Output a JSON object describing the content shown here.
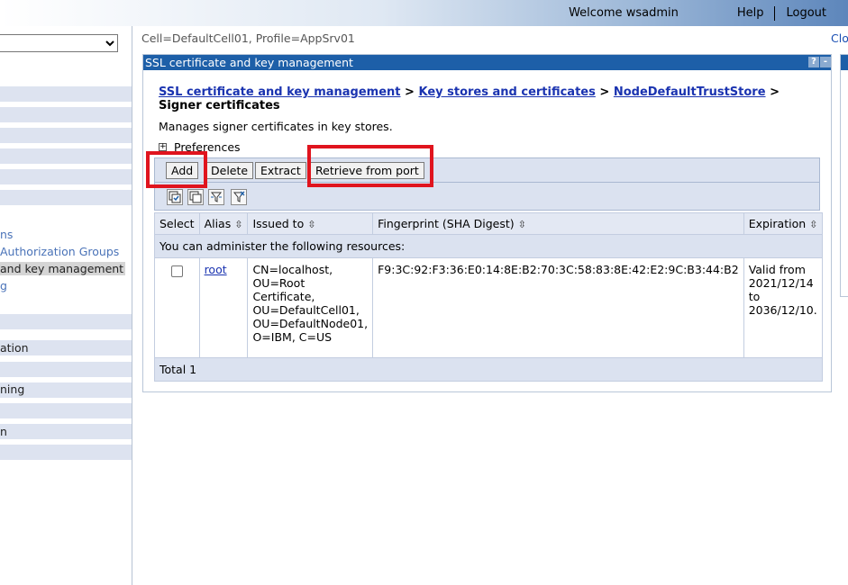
{
  "banner": {
    "welcome": "Welcome wsadmin",
    "help": "Help",
    "logout": "Logout"
  },
  "nav": {
    "select_value": "",
    "items": [
      {
        "label": "ns",
        "style": "link"
      },
      {
        "label": "Authorization Groups",
        "style": "link"
      },
      {
        "label": "and key management",
        "style": "selected"
      },
      {
        "label": "g",
        "style": "link"
      },
      {
        "label": "ation",
        "style": "plain"
      },
      {
        "label": "ning",
        "style": "plain"
      },
      {
        "label": "n",
        "style": "plain"
      }
    ]
  },
  "context": {
    "scope": "Cell=DefaultCell01, Profile=AppSrv01",
    "close_link": "Clo"
  },
  "panel": {
    "title": "SSL certificate and key management",
    "help_button": "?",
    "min_button": "-",
    "breadcrumb": {
      "items": [
        "SSL certificate and key management",
        "Key stores and certificates",
        "NodeDefaultTrustStore"
      ],
      "separator": ">",
      "current": "Signer certificates"
    },
    "description": "Manages signer certificates in key stores.",
    "preferences": "Preferences",
    "buttons": {
      "add": "Add",
      "delete": "Delete",
      "extract": "Extract",
      "retrieve": "Retrieve from port"
    },
    "icons": [
      "select-all-icon",
      "deselect-all-icon",
      "show-filter-icon",
      "clear-filter-icon"
    ]
  },
  "table": {
    "columns": [
      "Select",
      "Alias",
      "Issued to",
      "Fingerprint (SHA Digest)",
      "Expiration"
    ],
    "admin_text": "You can administer the following resources:",
    "rows": [
      {
        "alias": "root",
        "issued_to": "CN=localhost, OU=Root Certificate, OU=DefaultCell01, OU=DefaultNode01, O=IBM, C=US",
        "fingerprint": "F9:3C:92:F3:36:E0:14:8E:B2:70:3C:58:83:8E:42:E2:9C:B3:44:B2",
        "expiration": "Valid from 2021/12/14 to 2036/12/10."
      }
    ],
    "total": "Total 1"
  },
  "colors": {
    "title_bar": "#1d5fa8",
    "highlight": "#e0141e",
    "link": "#1a33b0",
    "table_band": "#dbe2f0"
  }
}
